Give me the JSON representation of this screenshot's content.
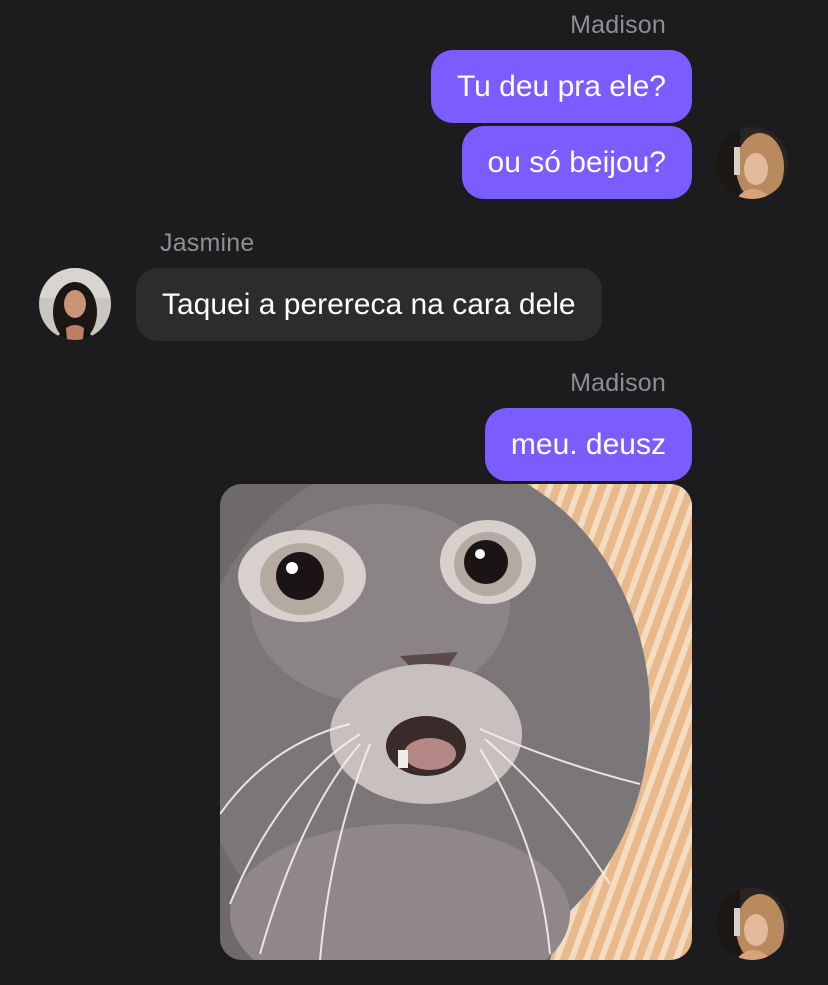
{
  "conversation": {
    "groups": [
      {
        "sender": "Madison",
        "messages": [
          "Tu deu pra ele?",
          "ou só beijou?"
        ]
      },
      {
        "sender": "Jasmine",
        "messages": [
          "Taquei a perereca na cara dele"
        ]
      },
      {
        "sender": "Madison",
        "messages": [
          "meu. deusz"
        ],
        "attachment": "cat-gif"
      }
    ]
  },
  "colors": {
    "background": "#1c1c1e",
    "outgoing_bubble": "#7b5cff",
    "incoming_bubble": "#2c2c2e",
    "sender_name": "#8e8e93",
    "message_text": "#ffffff"
  }
}
